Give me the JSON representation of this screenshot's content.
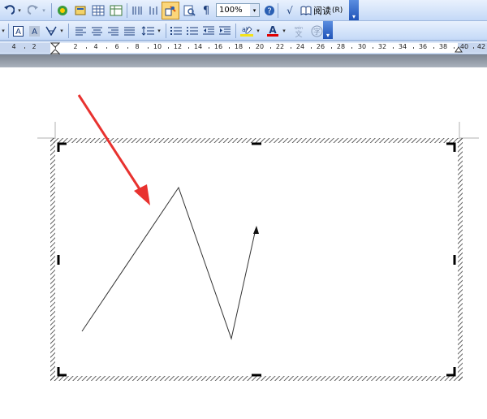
{
  "toolbar": {
    "zoom_value": "100%",
    "reading_label": "阅读",
    "reading_shortcut": "(R)",
    "help_label": "?",
    "redo_label": "↷",
    "undo_label": "↶",
    "sqrt_label": "√",
    "para_label": "¶"
  },
  "ruler": {
    "labels": [
      "4",
      "2",
      "2",
      "4",
      "6",
      "8",
      "10",
      "12",
      "14",
      "16",
      "18",
      "20",
      "22",
      "24",
      "26",
      "28",
      "30",
      "32",
      "34",
      "36",
      "38",
      "40",
      "42"
    ]
  },
  "colors": {
    "arrow": "#e8322f",
    "font_color_bar": "#e00000",
    "toolbar_gradient_top": "#e9f1fd",
    "toolbar_gradient_bottom": "#c4d9f7"
  },
  "icons": [
    "undo-icon",
    "redo-icon",
    "research-icon",
    "table-icon",
    "columns-icon",
    "drawing-icon",
    "doc-map-icon",
    "show-hide-icon",
    "help-icon",
    "sqrt-icon",
    "read-icon",
    "styles-icon",
    "bold-a-icon",
    "align-left-icon",
    "align-center-icon",
    "align-right-icon",
    "justify-icon",
    "line-spacing-icon",
    "numbering-icon",
    "bullets-icon",
    "decrease-indent-icon",
    "increase-indent-icon",
    "highlight-icon",
    "font-color-icon",
    "phonetic-icon",
    "enclose-icon"
  ]
}
